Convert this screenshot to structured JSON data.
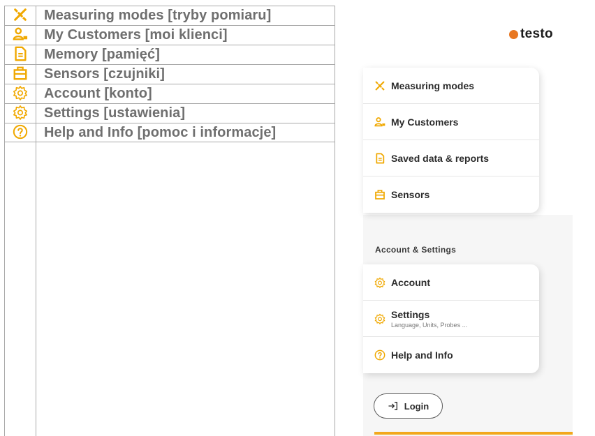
{
  "table": {
    "rows": [
      {
        "icon": "measuring-icon",
        "label": "Measuring modes [tryby pomiaru]"
      },
      {
        "icon": "customers-icon",
        "label": "My Customers [moi klienci]"
      },
      {
        "icon": "memory-icon",
        "label": "Memory [pamięć]"
      },
      {
        "icon": "sensors-icon",
        "label": "Sensors [czujniki]"
      },
      {
        "icon": "gear-icon",
        "label": "Account [konto]"
      },
      {
        "icon": "gear-icon",
        "label": "Settings [ustawienia]"
      },
      {
        "icon": "help-icon",
        "label": "Help and Info [pomoc i informacje]"
      }
    ]
  },
  "app": {
    "logo_text": "testo",
    "menu": [
      {
        "icon": "measuring-icon",
        "label": "Measuring modes"
      },
      {
        "icon": "customers-icon",
        "label": "My Customers"
      },
      {
        "icon": "memory-icon",
        "label": "Saved data & reports"
      },
      {
        "icon": "sensors-icon",
        "label": "Sensors"
      }
    ],
    "section_title": "Account & Settings",
    "settings_menu": [
      {
        "icon": "gear-icon",
        "label": "Account",
        "sub": ""
      },
      {
        "icon": "gear-icon",
        "label": "Settings",
        "sub": "Language, Units, Probes ..."
      },
      {
        "icon": "help-icon",
        "label": "Help and Info",
        "sub": ""
      }
    ],
    "login_label": "Login"
  },
  "colors": {
    "icon_accent": "#f0a800",
    "logo_dot": "#e87722",
    "bottom_bar": "#f2a81d",
    "table_text": "#6f6f6f"
  }
}
